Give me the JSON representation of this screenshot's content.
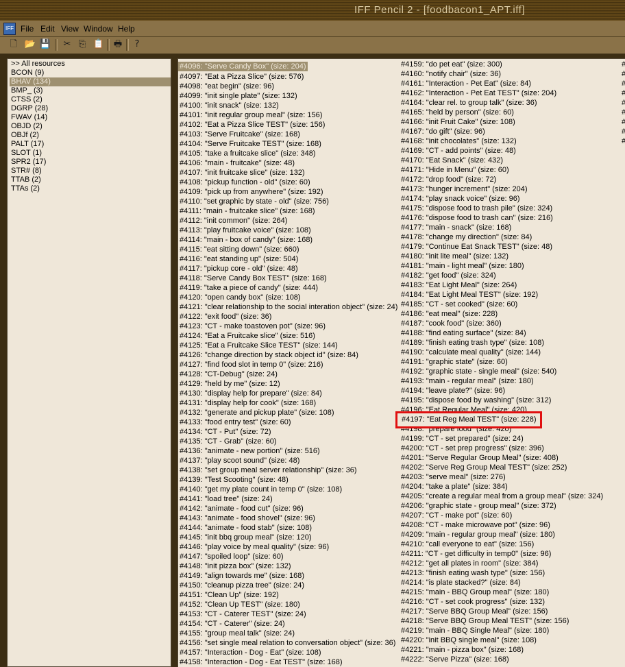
{
  "window": {
    "title": "IFF Pencil 2 - [foodbacon1_APT.iff]"
  },
  "menu": {
    "items": [
      "File",
      "Edit",
      "View",
      "Window",
      "Help"
    ]
  },
  "toolbar": {
    "buttons": [
      "new-icon",
      "open-icon",
      "save-icon",
      "cut-icon",
      "copy-icon",
      "paste-icon",
      "print-icon",
      "help-icon"
    ]
  },
  "resources": [
    ">> All resources",
    "BCON (9)",
    "BHAV (134)",
    "BMP_ (3)",
    "CTSS (2)",
    "DGRP (28)",
    "FWAV (14)",
    "OBJD (2)",
    "OBJf (2)",
    "PALT (17)",
    "SLOT (1)",
    "SPR2 (17)",
    "STR# (8)",
    "TTAB (2)",
    "TTAs (2)"
  ],
  "selected_resource_index": 2,
  "selected_bhav_index": 0,
  "highlighted_entry": "#4197: \"Eat Reg Meal TEST\" (size: 228)",
  "accent_colors": {
    "highlight_box": "#e01010",
    "selection": "#9e9070"
  },
  "bhav_col1": [
    "#4096: \"Serve Candy Box\" (size: 204)",
    "#4097: \"Eat a Pizza Slice\" (size: 576)",
    "#4098: \"eat begin\" (size: 96)",
    "#4099: \"init single plate\" (size: 132)",
    "#4100: \"init snack\" (size: 132)",
    "#4101: \"init regular group meal\" (size: 156)",
    "#4102: \"Eat a Pizza Slice TEST\" (size: 156)",
    "#4103: \"Serve Fruitcake\" (size: 168)",
    "#4104: \"Serve Fruitcake TEST\" (size: 168)",
    "#4105: \"take a fruitcake slice\" (size: 348)",
    "#4106: \"main - fruitcake\" (size: 48)",
    "#4107: \"init fruitcake slice\" (size: 132)",
    "#4108: \"pickup function - old\" (size: 60)",
    "#4109: \"pick up from anywhere\" (size: 192)",
    "#4110: \"set graphic by state - old\" (size: 756)",
    "#4111: \"main - fruitcake slice\" (size: 168)",
    "#4112: \"init common\" (size: 264)",
    "#4113: \"play fruitcake voice\" (size: 108)",
    "#4114: \"main - box of candy\" (size: 168)",
    "#4115: \"eat sitting down\" (size: 660)",
    "#4116: \"eat standing up\" (size: 504)",
    "#4117: \"pickup core - old\" (size: 48)",
    "#4118: \"Serve Candy Box TEST\" (size: 168)",
    "#4119: \"take a piece of candy\" (size: 444)",
    "#4120: \"open candy box\" (size: 108)",
    "#4121: \"clear relationship to the social interation object\" (size: 24)",
    "#4122: \"exit food\" (size: 36)",
    "#4123: \"CT - make toastoven pot\" (size: 96)",
    "#4124: \"Eat a Fruitcake slice\" (size: 516)",
    "#4125: \"Eat a Fruitcake Slice TEST\" (size: 144)",
    "#4126: \"change direction by stack object id\" (size: 84)",
    "#4127: \"find food slot in temp 0\" (size: 216)",
    "#4128: \"CT-Debug\" (size: 24)",
    "#4129: \"held by me\" (size: 12)",
    "#4130: \"display help for prepare\" (size: 84)",
    "#4131: \"display help for cook\" (size: 168)",
    "#4132: \"generate and pickup plate\" (size: 108)",
    "#4133: \"food entry test\" (size: 60)",
    "#4134: \"CT - Put\" (size: 72)",
    "#4135: \"CT - Grab\" (size: 60)",
    "#4136: \"animate - new portion\" (size: 516)",
    "#4137: \"play scoot sound\" (size: 48)",
    "#4138: \"set group meal server relationship\" (size: 36)",
    "#4139: \"Test Scooting\" (size: 48)",
    "#4140: \"get my plate count in temp 0\" (size: 108)",
    "#4141: \"load tree\" (size: 24)",
    "#4142: \"animate - food cut\" (size: 96)",
    "#4143: \"animate - food shovel\" (size: 96)",
    "#4144: \"animate - food stab\" (size: 108)",
    "#4145: \"init bbq group meal\" (size: 120)",
    "#4146: \"play voice by meal quality\" (size: 96)",
    "#4147: \"spoiled loop\" (size: 60)",
    "#4148: \"init pizza box\" (size: 132)",
    "#4149: \"align towards me\" (size: 168)",
    "#4150: \"cleanup pizza tree\" (size: 24)",
    "#4151: \"Clean Up\" (size: 192)",
    "#4152: \"Clean Up TEST\" (size: 180)",
    "#4153: \"CT - Caterer TEST\" (size: 24)",
    "#4154: \"CT - Caterer\" (size: 24)",
    "#4155: \"group meal talk\" (size: 24)",
    "#4156: \"set single meal relation to conversation object\" (size: 36)",
    "#4157: \"Interaction - Dog - Eat\" (size: 108)",
    "#4158: \"Interaction - Dog - Eat TEST\" (size: 168)"
  ],
  "bhav_col2": [
    "#4159: \"do pet eat\" (size: 300)",
    "#4160: \"notify chair\" (size: 36)",
    "#4161: \"Interaction - Pet Eat\" (size: 84)",
    "#4162: \"Interaction - Pet Eat TEST\" (size: 204)",
    "#4164: \"clear rel. to group talk\" (size: 36)",
    "#4165: \"held by person\" (size: 60)",
    "#4166: \"init Fruit Cake\" (size: 108)",
    "#4167: \"do gift\" (size: 96)",
    "#4168: \"init chocolates\" (size: 132)",
    "#4169: \"CT - add points\" (size: 48)",
    "#4170: \"Eat Snack\" (size: 432)",
    "#4171: \"Hide in Menu\" (size: 60)",
    "#4172: \"drop food\" (size: 72)",
    "#4173: \"hunger increment\" (size: 204)",
    "#4174: \"play snack voice\" (size: 96)",
    "#4175: \"dispose food to trash pile\" (size: 324)",
    "#4176: \"dispose food to trash can\" (size: 216)",
    "#4177: \"main - snack\" (size: 168)",
    "#4178: \"change my direction\" (size: 84)",
    "#4179: \"Continue Eat Snack TEST\" (size: 48)",
    "#4180: \"init lite meal\" (size: 132)",
    "#4181: \"main - light meal\" (size: 180)",
    "#4182: \"get food\" (size: 324)",
    "#4183: \"Eat Light Meal\" (size: 264)",
    "#4184: \"Eat Light Meal TEST\" (size: 192)",
    "#4185: \"CT - set cooked\" (size: 60)",
    "#4186: \"eat meal\" (size: 228)",
    "#4187: \"cook food\" (size: 360)",
    "#4188: \"find eating surface\" (size: 84)",
    "#4189: \"finish eating trash type\" (size: 108)",
    "#4190: \"calculate meal quality\" (size: 144)",
    "#4191: \"graphic state\" (size: 60)",
    "#4192: \"graphic state - single meal\" (size: 540)",
    "#4193: \"main - regular meal\" (size: 180)",
    "#4194: \"leave plate?\" (size: 96)",
    "#4195: \"dispose food by washing\" (size: 312)",
    "#4196: \"Eat Regular Meal\" (size: 420)",
    "#4198: \"prepare food\" (size: 420)",
    "#4199: \"CT - set prepared\" (size: 24)",
    "#4200: \"CT - set prep progress\" (size: 396)",
    "#4201: \"Serve Regular Group Meal\" (size: 408)",
    "#4202: \"Serve Reg Group Meal TEST\" (size: 252)",
    "#4203: \"serve meal\" (size: 276)",
    "#4204: \"take a plate\" (size: 384)",
    "#4205: \"create a regular meal from a group meal\" (size: 324)",
    "#4206: \"graphic state - group meal\" (size: 372)",
    "#4207: \"CT - make pot\" (size: 60)",
    "#4208: \"CT - make microwave pot\" (size: 96)",
    "#4209: \"main - regular group meal\" (size: 180)",
    "#4210: \"call everyone to eat\" (size: 156)",
    "#4211: \"CT - get difficulty in temp0\" (size: 96)",
    "#4212: \"get all plates in room\" (size: 384)",
    "#4213: \"finish eating wash type\" (size: 156)",
    "#4214: \"is plate stacked?\" (size: 84)",
    "#4215: \"main - BBQ Group meal\" (size: 180)",
    "#4216: \"CT - set cook progress\" (size: 132)",
    "#4217: \"Serve BBQ Group Meal\" (size: 156)",
    "#4218: \"Serve BBQ Group Meal TEST\" (size: 156)",
    "#4219: \"main - BBQ Single Meal\" (size: 180)",
    "#4220: \"init BBQ single meal\" (size: 108)",
    "#4221: \"main - pizza box\" (size: 168)",
    "#4222: \"Serve Pizza\" (size: 168)"
  ],
  "bhav_col3": [
    "#",
    "#",
    "#",
    "#",
    "#",
    "#",
    "#",
    "#",
    "#"
  ]
}
